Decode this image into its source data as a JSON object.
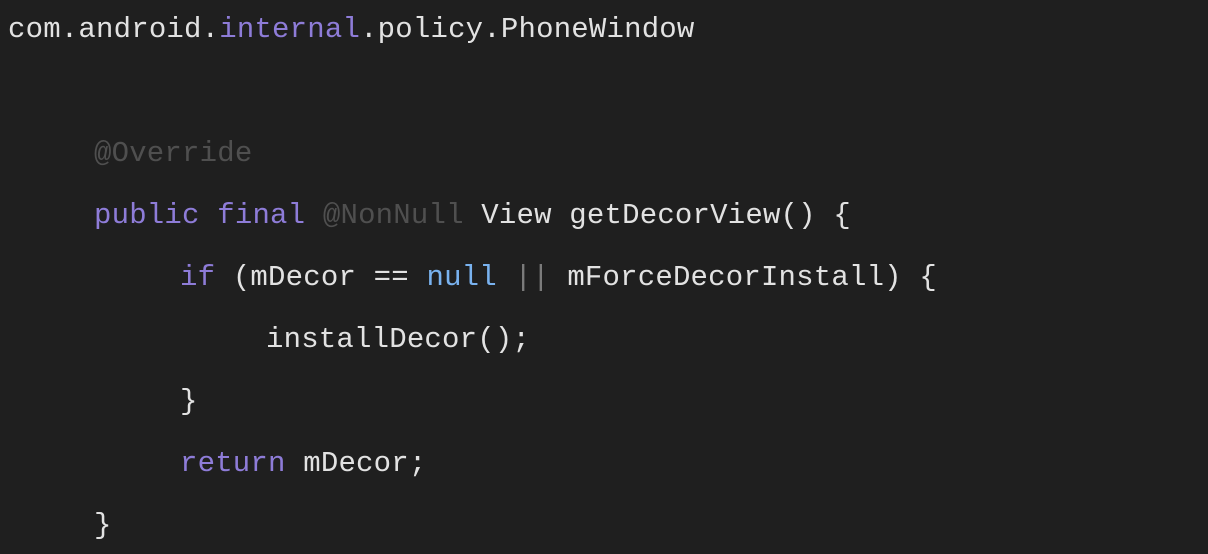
{
  "code": {
    "header": {
      "part1": "com.android.",
      "part2": "internal",
      "part3": ".policy.PhoneWindow"
    },
    "lines": {
      "override": "@Override",
      "signature": {
        "kw_public": "public",
        "kw_final": "final",
        "annotation": "@NonNull",
        "rest": "View getDecorView() {"
      },
      "if_line": {
        "kw_if": "if",
        "part1": "(mDecor == ",
        "kw_null": "null",
        "op_or": "||",
        "part2": "mForceDecorInstall) {"
      },
      "install_call": "installDecor();",
      "if_close": "}",
      "return_line": {
        "kw_return": "return",
        "rest": "mDecor;"
      },
      "method_close": "}"
    }
  },
  "colors": {
    "background": "#1f1f1f",
    "text": "#e2e2e2",
    "keyword": "#8e7cd8",
    "annotation": "#4f4f4f",
    "literal": "#79b2ef"
  }
}
